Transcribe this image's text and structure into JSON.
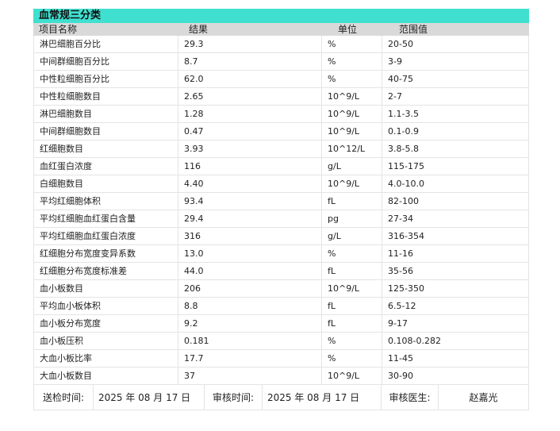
{
  "report": {
    "title": "血常规三分类",
    "headers": {
      "name": "项目名称",
      "result": "结果",
      "unit": "单位",
      "range": "范围值"
    },
    "rows": [
      {
        "name": "淋巴细胞百分比",
        "result": "29.3",
        "unit": "%",
        "range": "20-50"
      },
      {
        "name": "中间群细胞百分比",
        "result": "8.7",
        "unit": "%",
        "range": "3-9"
      },
      {
        "name": "中性粒细胞百分比",
        "result": "62.0",
        "unit": "%",
        "range": "40-75"
      },
      {
        "name": "中性粒细胞数目",
        "result": "2.65",
        "unit": "10^9/L",
        "range": "2-7"
      },
      {
        "name": "淋巴细胞数目",
        "result": "1.28",
        "unit": "10^9/L",
        "range": "1.1-3.5"
      },
      {
        "name": "中间群细胞数目",
        "result": "0.47",
        "unit": "10^9/L",
        "range": "0.1-0.9"
      },
      {
        "name": "红细胞数目",
        "result": "3.93",
        "unit": "10^12/L",
        "range": "3.8-5.8"
      },
      {
        "name": "血红蛋白浓度",
        "result": "116",
        "unit": "g/L",
        "range": "115-175"
      },
      {
        "name": "白细胞数目",
        "result": "4.40",
        "unit": "10^9/L",
        "range": "4.0-10.0"
      },
      {
        "name": "平均红细胞体积",
        "result": "93.4",
        "unit": "fL",
        "range": "82-100"
      },
      {
        "name": "平均红细胞血红蛋白含量",
        "result": "29.4",
        "unit": "pg",
        "range": "27-34"
      },
      {
        "name": "平均红细胞血红蛋白浓度",
        "result": "316",
        "unit": "g/L",
        "range": "316-354"
      },
      {
        "name": "红细胞分布宽度变异系数",
        "result": "13.0",
        "unit": "%",
        "range": "11-16"
      },
      {
        "name": "红细胞分布宽度标准差",
        "result": "44.0",
        "unit": "fL",
        "range": "35-56"
      },
      {
        "name": "血小板数目",
        "result": "206",
        "unit": "10^9/L",
        "range": "125-350"
      },
      {
        "name": "平均血小板体积",
        "result": "8.8",
        "unit": "fL",
        "range": "6.5-12"
      },
      {
        "name": "血小板分布宽度",
        "result": "9.2",
        "unit": "fL",
        "range": "9-17"
      },
      {
        "name": "血小板压积",
        "result": "0.181",
        "unit": "%",
        "range": "0.108-0.282"
      },
      {
        "name": "大血小板比率",
        "result": "17.7",
        "unit": "%",
        "range": "11-45"
      },
      {
        "name": "大血小板数目",
        "result": "37",
        "unit": "10^9/L",
        "range": "30-90"
      }
    ],
    "footer": {
      "submit_label": "送检时间:",
      "submit_date": "2025 年 08 月 17 日",
      "review_label": "审核时间:",
      "review_date": "2025 年 08 月 17 日",
      "doctor_label": "审核医生:",
      "doctor_name": "赵嘉光"
    }
  },
  "colors": {
    "title_bg": "#40e0d0",
    "header_bg": "#d9d9d9",
    "grid": "#e4e4e4"
  }
}
